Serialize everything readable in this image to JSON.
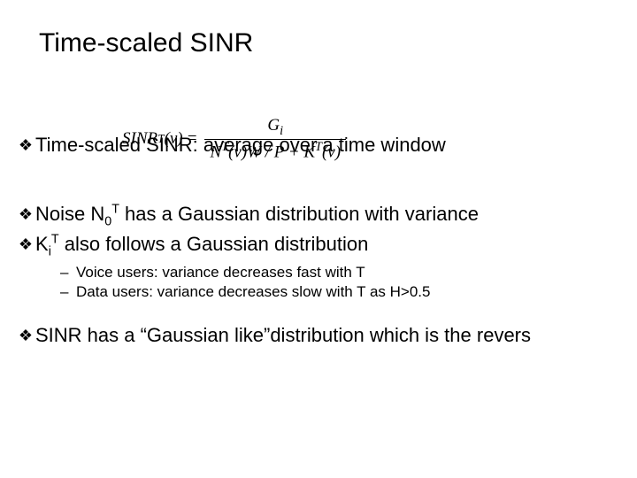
{
  "title": "Time-scaled SINR",
  "formula": {
    "lhs_main": "SINR",
    "lhs_sup": "T",
    "lhs_arg": "(v)",
    "eq": "=",
    "num": "G",
    "num_sub": "i",
    "den_left": "N",
    "den_left_sup": "T",
    "den_mid": "(v)W / P + K",
    "den_right_sup": "T",
    "den_arg": "(v)"
  },
  "bullets": {
    "b1": "Time-scaled SINR: average over a time window",
    "b2_pre": "Noise N",
    "b2_sub": "0",
    "b2_sup": "T",
    "b2_post": " has a Gaussian distribution with variance",
    "b3_pre": "K",
    "b3_sub": "i",
    "b3_sup": "T",
    "b3_post": " also follows a Gaussian distribution",
    "s1": "Voice users: variance decreases fast with T",
    "s2": "Data users: variance decreases slow with T as H>0.5",
    "b4": "SINR has a “Gaussian like”distribution which is the revers"
  },
  "glyph": {
    "diamond": "❖",
    "dash": "–"
  }
}
